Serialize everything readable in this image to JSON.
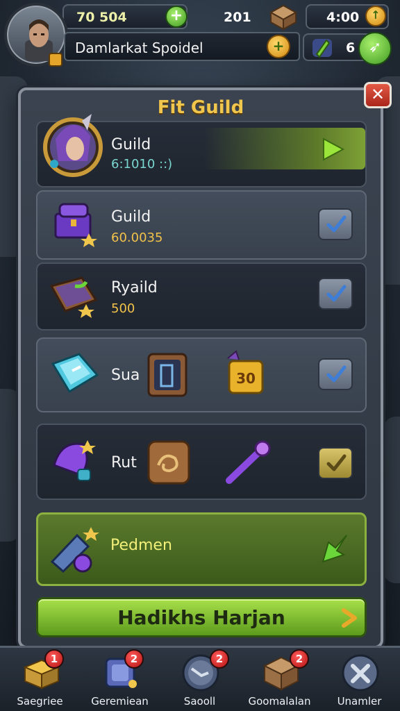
{
  "header": {
    "gold_amount": "70 504",
    "gems_count": "201",
    "timer": "4:00",
    "player_name": "Damlarkat Spoidel",
    "energy_count": "6"
  },
  "panel": {
    "title": "Fit Guild",
    "close_label": "✕",
    "rows": [
      {
        "title": "Guild",
        "subtitle": "6:1010 ::)"
      },
      {
        "title": "Guild",
        "subtitle": "60.0035"
      },
      {
        "title": "Ryaild",
        "subtitle": "500"
      },
      {
        "title": "Sua"
      },
      {
        "title": "Rut"
      },
      {
        "title": "Pedmen"
      }
    ],
    "item_value_label": "30",
    "cta_label": "Hadikhs Harjan"
  },
  "bottom_nav": [
    {
      "label": "Saegriee",
      "badge": "1"
    },
    {
      "label": "Geremiean",
      "badge": "2"
    },
    {
      "label": "Saooll",
      "badge": "2"
    },
    {
      "label": "Goomalalan",
      "badge": "2"
    },
    {
      "label": "Unamler"
    }
  ],
  "colors": {
    "panel_title": "#f0c64c",
    "cta_green": "#8fd23a",
    "badge_red": "#d32121",
    "gold_text": "#f2c24a"
  }
}
